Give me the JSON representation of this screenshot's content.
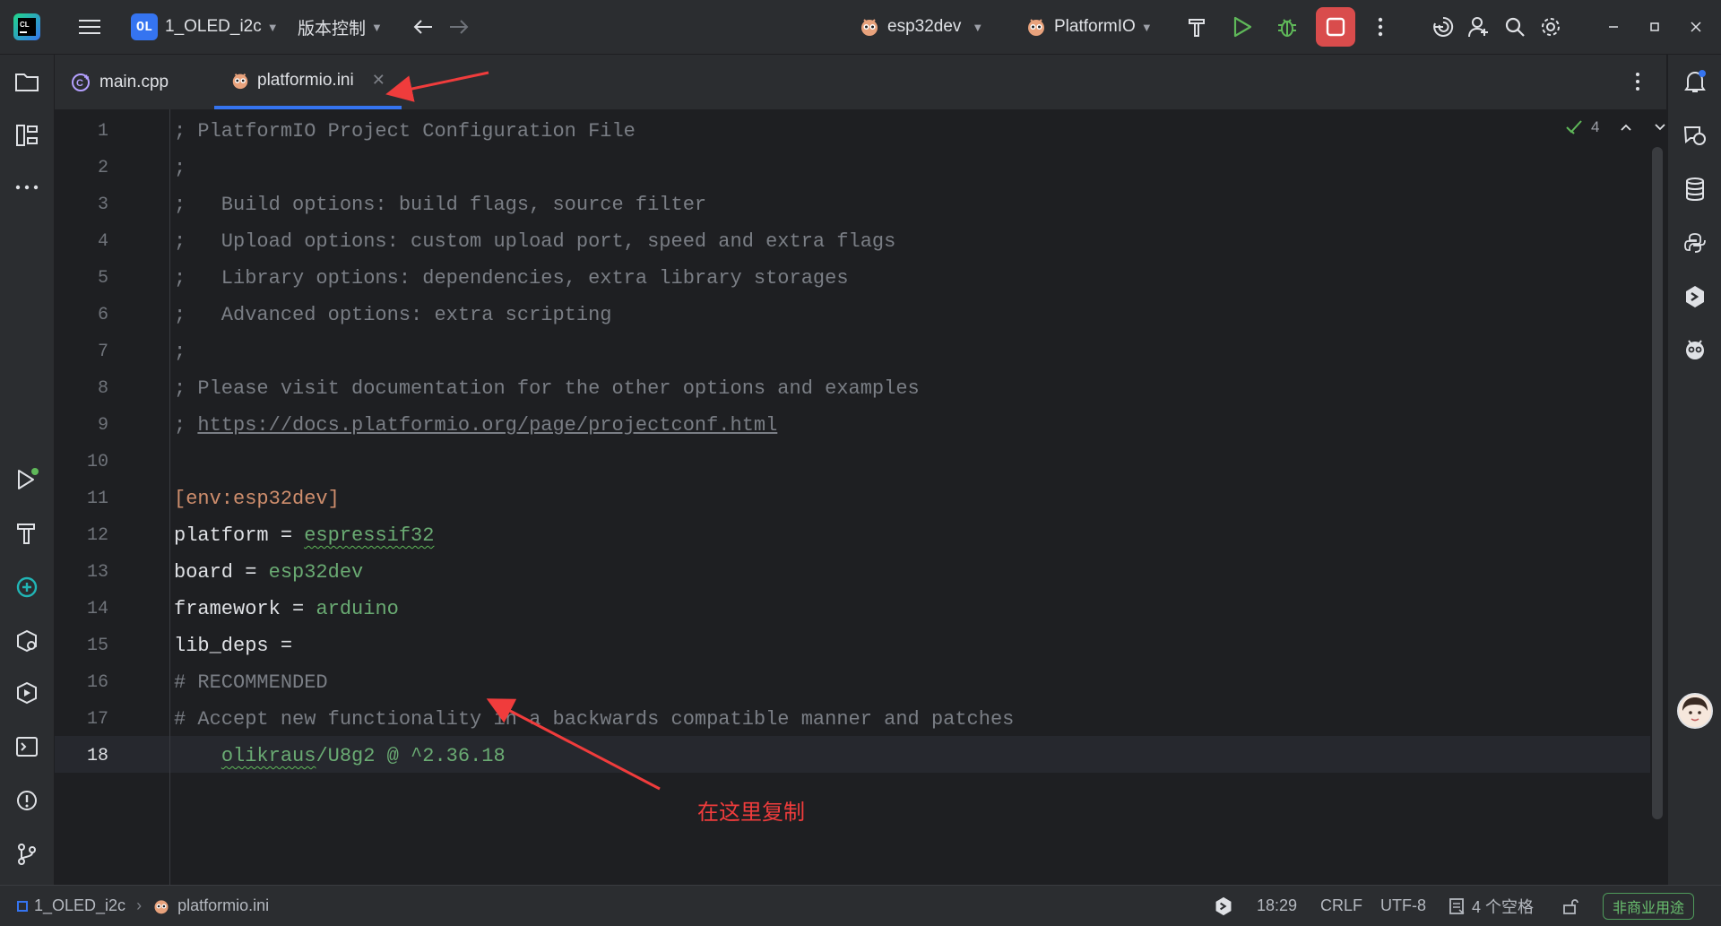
{
  "titlebar": {
    "project_badge": "OL",
    "project_name": "1_OLED_i2c",
    "vcs_menu": "版本控制",
    "run_config": "esp32dev",
    "platformio_menu": "PlatformIO"
  },
  "tabs": [
    {
      "label": "main.cpp",
      "icon": "cpp-file-icon",
      "active": false
    },
    {
      "label": "platformio.ini",
      "icon": "platformio-file-icon",
      "active": true
    }
  ],
  "editor": {
    "inspection_count": "4",
    "current_line": 18,
    "lines": [
      {
        "n": "1",
        "text": "; PlatformIO Project Configuration File"
      },
      {
        "n": "2",
        "text": ";"
      },
      {
        "n": "3",
        "text": ";   Build options: build flags, source filter"
      },
      {
        "n": "4",
        "text": ";   Upload options: custom upload port, speed and extra flags"
      },
      {
        "n": "5",
        "text": ";   Library options: dependencies, extra library storages"
      },
      {
        "n": "6",
        "text": ";   Advanced options: extra scripting"
      },
      {
        "n": "7",
        "text": ";"
      },
      {
        "n": "8",
        "text": "; Please visit documentation for the other options and examples"
      },
      {
        "n": "9",
        "prefix": "; ",
        "link": "https://docs.platformio.org/page/projectconf.html"
      },
      {
        "n": "10",
        "text": ""
      },
      {
        "n": "11",
        "text": "[env:esp32dev]"
      },
      {
        "n": "12",
        "key": "platform",
        "eq": " = ",
        "value": "espressif32"
      },
      {
        "n": "13",
        "key": "board",
        "eq": " = ",
        "value": "esp32dev"
      },
      {
        "n": "14",
        "key": "framework",
        "eq": " = ",
        "value": "arduino"
      },
      {
        "n": "15",
        "key": "lib_deps",
        "eq": " =",
        "value": ""
      },
      {
        "n": "16",
        "text": "# RECOMMENDED"
      },
      {
        "n": "17",
        "text": "# Accept new functionality in a backwards compatible manner and patches"
      },
      {
        "n": "18",
        "indent": "    ",
        "value_squiggle": "olikraus",
        "value_rest": "/U8g2 @ ^2.36.18"
      }
    ]
  },
  "annotation": {
    "text": "在这里复制",
    "color": "#f03c3c"
  },
  "statusbar": {
    "breadcrumb_project": "1_OLED_i2c",
    "breadcrumb_file": "platformio.ini",
    "cursor_position": "18:29",
    "line_separator": "CRLF",
    "encoding": "UTF-8",
    "indent": "4 个空格",
    "license_badge": "非商业用途"
  },
  "colors": {
    "background": "#1e1f22",
    "panel": "#2b2d30",
    "accent": "#3574f0",
    "stop": "#d94c4c",
    "comment": "#7a7e85",
    "section": "#cf8e6d",
    "string": "#6aab73"
  }
}
